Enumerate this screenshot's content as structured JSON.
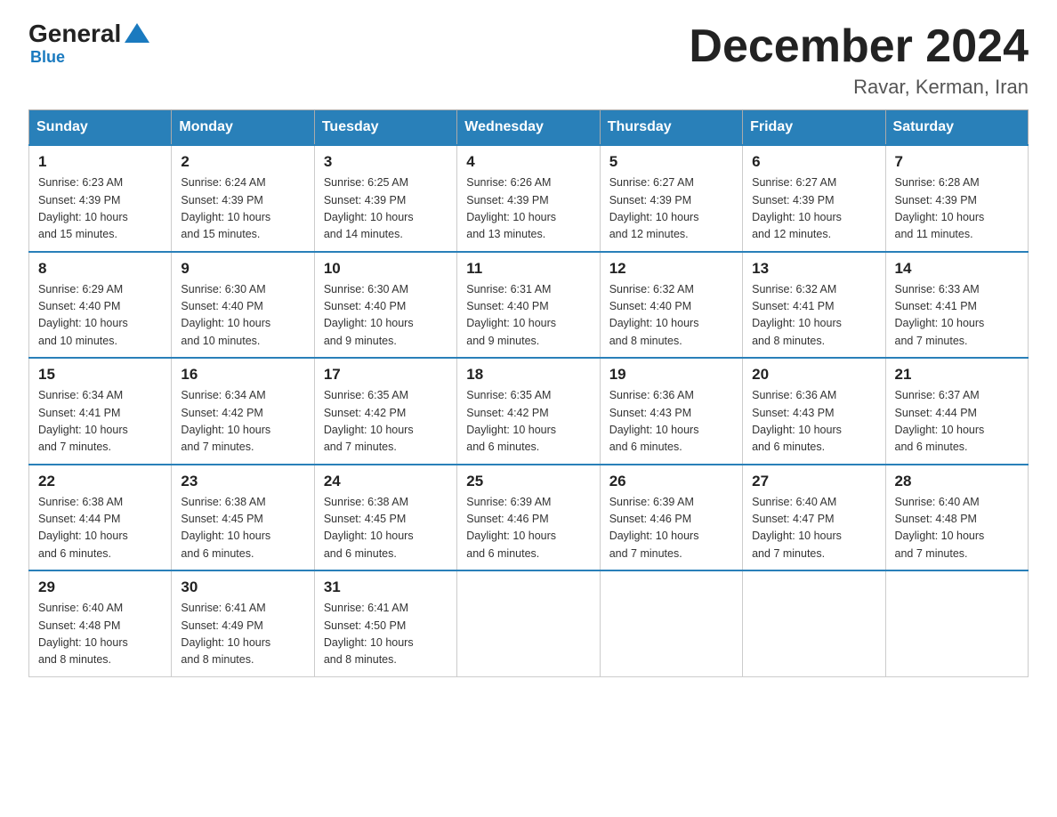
{
  "logo": {
    "general": "General",
    "blue": "Blue"
  },
  "header": {
    "title": "December 2024",
    "subtitle": "Ravar, Kerman, Iran"
  },
  "days_of_week": [
    "Sunday",
    "Monday",
    "Tuesday",
    "Wednesday",
    "Thursday",
    "Friday",
    "Saturday"
  ],
  "weeks": [
    [
      {
        "day": "1",
        "sunrise": "6:23 AM",
        "sunset": "4:39 PM",
        "daylight": "10 hours and 15 minutes."
      },
      {
        "day": "2",
        "sunrise": "6:24 AM",
        "sunset": "4:39 PM",
        "daylight": "10 hours and 15 minutes."
      },
      {
        "day": "3",
        "sunrise": "6:25 AM",
        "sunset": "4:39 PM",
        "daylight": "10 hours and 14 minutes."
      },
      {
        "day": "4",
        "sunrise": "6:26 AM",
        "sunset": "4:39 PM",
        "daylight": "10 hours and 13 minutes."
      },
      {
        "day": "5",
        "sunrise": "6:27 AM",
        "sunset": "4:39 PM",
        "daylight": "10 hours and 12 minutes."
      },
      {
        "day": "6",
        "sunrise": "6:27 AM",
        "sunset": "4:39 PM",
        "daylight": "10 hours and 12 minutes."
      },
      {
        "day": "7",
        "sunrise": "6:28 AM",
        "sunset": "4:39 PM",
        "daylight": "10 hours and 11 minutes."
      }
    ],
    [
      {
        "day": "8",
        "sunrise": "6:29 AM",
        "sunset": "4:40 PM",
        "daylight": "10 hours and 10 minutes."
      },
      {
        "day": "9",
        "sunrise": "6:30 AM",
        "sunset": "4:40 PM",
        "daylight": "10 hours and 10 minutes."
      },
      {
        "day": "10",
        "sunrise": "6:30 AM",
        "sunset": "4:40 PM",
        "daylight": "10 hours and 9 minutes."
      },
      {
        "day": "11",
        "sunrise": "6:31 AM",
        "sunset": "4:40 PM",
        "daylight": "10 hours and 9 minutes."
      },
      {
        "day": "12",
        "sunrise": "6:32 AM",
        "sunset": "4:40 PM",
        "daylight": "10 hours and 8 minutes."
      },
      {
        "day": "13",
        "sunrise": "6:32 AM",
        "sunset": "4:41 PM",
        "daylight": "10 hours and 8 minutes."
      },
      {
        "day": "14",
        "sunrise": "6:33 AM",
        "sunset": "4:41 PM",
        "daylight": "10 hours and 7 minutes."
      }
    ],
    [
      {
        "day": "15",
        "sunrise": "6:34 AM",
        "sunset": "4:41 PM",
        "daylight": "10 hours and 7 minutes."
      },
      {
        "day": "16",
        "sunrise": "6:34 AM",
        "sunset": "4:42 PM",
        "daylight": "10 hours and 7 minutes."
      },
      {
        "day": "17",
        "sunrise": "6:35 AM",
        "sunset": "4:42 PM",
        "daylight": "10 hours and 7 minutes."
      },
      {
        "day": "18",
        "sunrise": "6:35 AM",
        "sunset": "4:42 PM",
        "daylight": "10 hours and 6 minutes."
      },
      {
        "day": "19",
        "sunrise": "6:36 AM",
        "sunset": "4:43 PM",
        "daylight": "10 hours and 6 minutes."
      },
      {
        "day": "20",
        "sunrise": "6:36 AM",
        "sunset": "4:43 PM",
        "daylight": "10 hours and 6 minutes."
      },
      {
        "day": "21",
        "sunrise": "6:37 AM",
        "sunset": "4:44 PM",
        "daylight": "10 hours and 6 minutes."
      }
    ],
    [
      {
        "day": "22",
        "sunrise": "6:38 AM",
        "sunset": "4:44 PM",
        "daylight": "10 hours and 6 minutes."
      },
      {
        "day": "23",
        "sunrise": "6:38 AM",
        "sunset": "4:45 PM",
        "daylight": "10 hours and 6 minutes."
      },
      {
        "day": "24",
        "sunrise": "6:38 AM",
        "sunset": "4:45 PM",
        "daylight": "10 hours and 6 minutes."
      },
      {
        "day": "25",
        "sunrise": "6:39 AM",
        "sunset": "4:46 PM",
        "daylight": "10 hours and 6 minutes."
      },
      {
        "day": "26",
        "sunrise": "6:39 AM",
        "sunset": "4:46 PM",
        "daylight": "10 hours and 7 minutes."
      },
      {
        "day": "27",
        "sunrise": "6:40 AM",
        "sunset": "4:47 PM",
        "daylight": "10 hours and 7 minutes."
      },
      {
        "day": "28",
        "sunrise": "6:40 AM",
        "sunset": "4:48 PM",
        "daylight": "10 hours and 7 minutes."
      }
    ],
    [
      {
        "day": "29",
        "sunrise": "6:40 AM",
        "sunset": "4:48 PM",
        "daylight": "10 hours and 8 minutes."
      },
      {
        "day": "30",
        "sunrise": "6:41 AM",
        "sunset": "4:49 PM",
        "daylight": "10 hours and 8 minutes."
      },
      {
        "day": "31",
        "sunrise": "6:41 AM",
        "sunset": "4:50 PM",
        "daylight": "10 hours and 8 minutes."
      },
      null,
      null,
      null,
      null
    ]
  ],
  "labels": {
    "sunrise": "Sunrise:",
    "sunset": "Sunset:",
    "daylight": "Daylight:"
  }
}
